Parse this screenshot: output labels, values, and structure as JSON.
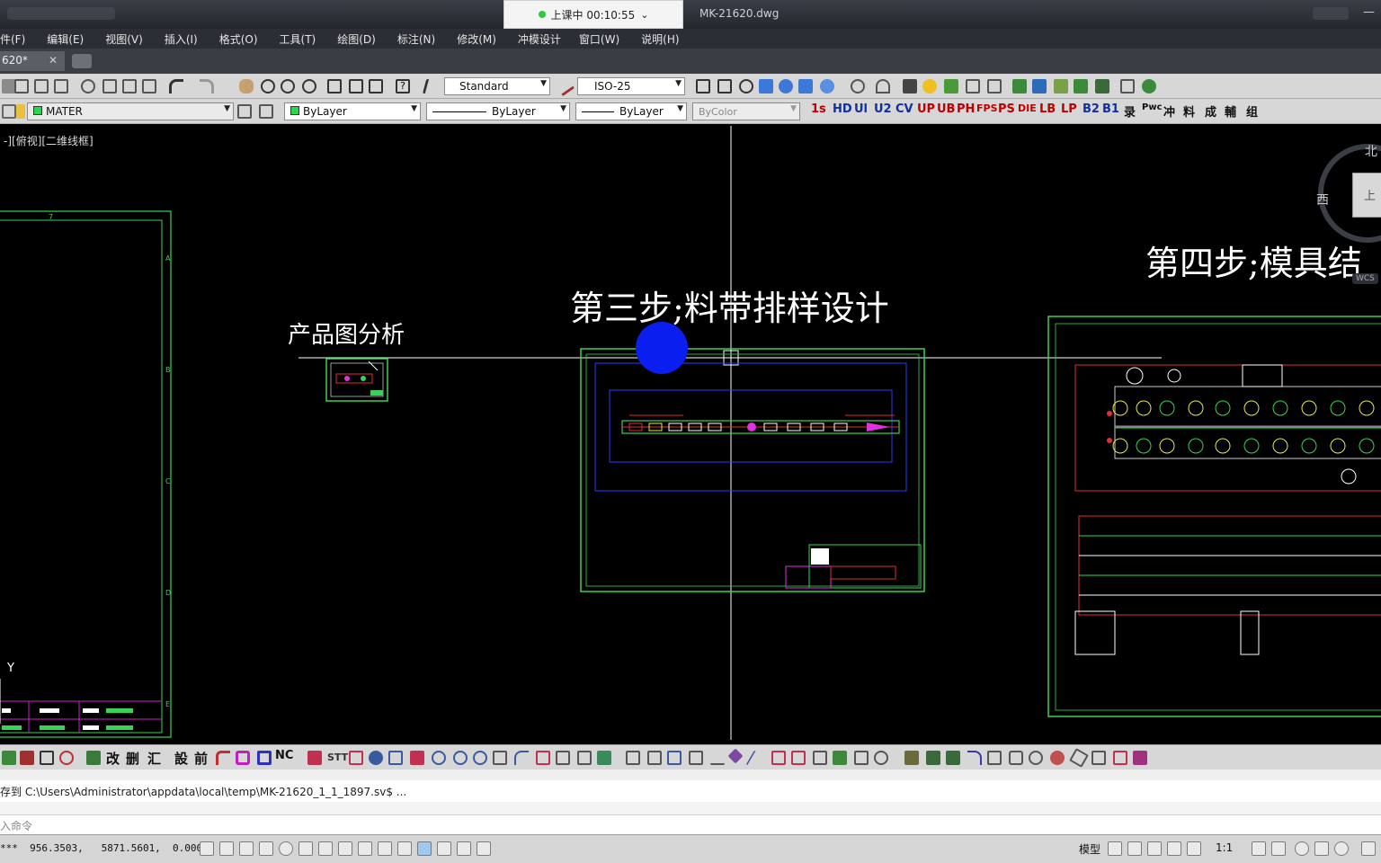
{
  "titlebar": {
    "class_status": "上课中 00:10:55",
    "chevron": "⌄",
    "file_title": "MK-21620.dwg",
    "min_glyph": "—",
    "max_glyph": "▭"
  },
  "menu": [
    "件(F)",
    "编辑(E)",
    "视图(V)",
    "插入(I)",
    "格式(O)",
    "工具(T)",
    "绘图(D)",
    "标注(N)",
    "修改(M)",
    "冲模设计",
    "窗口(W)",
    "说明(H)"
  ],
  "file_tab": {
    "label": "620*",
    "close": "✕"
  },
  "toolbar1": {
    "text_style": "Standard",
    "dim_style": "ISO-25"
  },
  "toolbar2": {
    "layer": "MATER",
    "color": "ByLayer",
    "linetype": "ByLayer",
    "lineweight": "ByLayer",
    "plotstyle": "ByColor",
    "red_buttons": [
      "1s",
      "HD",
      "Ul",
      "U2",
      "CV",
      "UP",
      "UB",
      "PH",
      "FPS",
      "PS",
      "DIE",
      "LB",
      "LP",
      "B2",
      "B1"
    ],
    "black_buttons": [
      "录",
      "Pwc",
      "冲",
      "料",
      "成",
      "輔",
      "组"
    ]
  },
  "viewport": {
    "label": "-][俯视][二维线框]"
  },
  "drawing_titles": {
    "step_product": "产品图分析",
    "step3": "第三步;料带排样设计",
    "step4": "第四步;模具结"
  },
  "viewcube": {
    "north": "北",
    "west": "西",
    "face": "上",
    "wcs": "WCS"
  },
  "axis_label": "Y",
  "bottom_toolbar": {
    "cn_buttons": [
      "改",
      "删",
      "汇",
      "設",
      "前"
    ],
    "nc": "NC",
    "stt": "STT"
  },
  "command": {
    "history": "存到 C:\\Users\\Administrator\\appdata\\local\\temp\\MK-21620_1_1_1897.sv$ ...",
    "input_placeholder": "入命令"
  },
  "status": {
    "coords": "***  956.3503,   5871.5601,  0.0000",
    "model": "模型",
    "scale": "1:1"
  },
  "colors": {
    "frame_green": "#39d353",
    "blue_marker": "#0a1ef0",
    "magenta": "#e032e0",
    "red": "#ff2a2a",
    "yellow": "#e8e84a"
  }
}
